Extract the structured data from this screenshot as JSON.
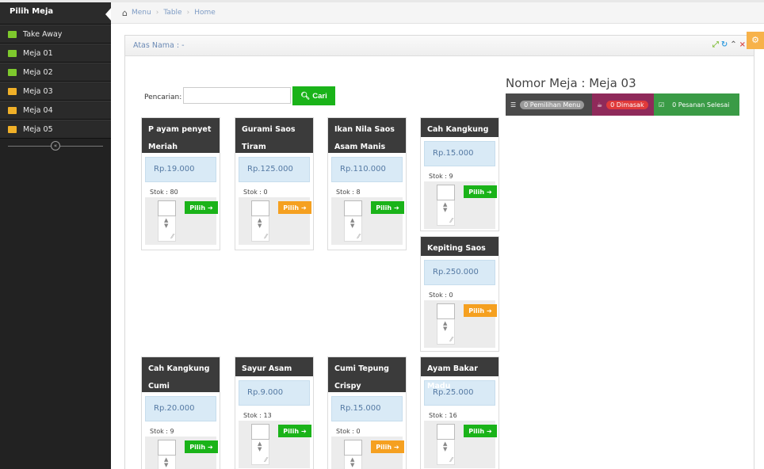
{
  "sidebar": {
    "header": "Pilih Meja",
    "items": [
      {
        "label": "Take Away",
        "icon": "takeaway-icon",
        "color": "#7ec92d"
      },
      {
        "label": "Meja 01",
        "icon": "table-icon",
        "color": "#7ec92d"
      },
      {
        "label": "Meja 02",
        "icon": "table-icon",
        "color": "#7ec92d"
      },
      {
        "label": "Meja 03",
        "icon": "table-icon",
        "color": "#f0b028"
      },
      {
        "label": "Meja 04",
        "icon": "table-icon",
        "color": "#f0b028"
      },
      {
        "label": "Meja 05",
        "icon": "table-icon",
        "color": "#f0b028"
      }
    ]
  },
  "breadcrumb": {
    "items": [
      "Menu",
      "Table",
      "Home"
    ]
  },
  "panel": {
    "title": "Atas Nama : -"
  },
  "search": {
    "label": "Pencarian:",
    "value": "",
    "button": "Cari"
  },
  "nomor_meja": "Nomor Meja : Meja 03",
  "badges": [
    {
      "label": "0 Pemilihan Menu",
      "color": "#4a4a4a"
    },
    {
      "label": "0 Dimasak",
      "color": "#8f2a5a"
    },
    {
      "label": "0 Pesanan Selesai",
      "color": "#3a9b46"
    }
  ],
  "pilih_label": "Pilih",
  "cards": [
    {
      "name": "P ayam penyet Meriah",
      "price": "Rp.19.000",
      "stok": "Stok : 80",
      "status": "green"
    },
    {
      "name": "Gurami Saos Tiram",
      "price": "Rp.125.000",
      "stok": "Stok : 0",
      "status": "orange"
    },
    {
      "name": "Ikan Nila Saos Asam Manis",
      "price": "Rp.110.000",
      "stok": "Stok : 8",
      "status": "green"
    },
    {
      "name": "Cah Kangkung",
      "price": "Rp.15.000",
      "stok": "Stok : 9",
      "status": "green"
    },
    {
      "name": "Kepiting Saos",
      "price": "Rp.250.000",
      "stok": "Stok : 0",
      "status": "orange"
    },
    {
      "name": "Cah Kangkung Cumi",
      "price": "Rp.20.000",
      "stok": "Stok : 9",
      "status": "green"
    },
    {
      "name": "Sayur Asam",
      "price": "Rp.9.000",
      "stok": "Stok : 13",
      "status": "green"
    },
    {
      "name": "Cumi Tepung Crispy",
      "price": "Rp.15.000",
      "stok": "Stok : 0",
      "status": "orange"
    },
    {
      "name": "Ayam Bakar Madu",
      "price": "Rp.25.000",
      "stok": "Stok : 16",
      "status": "green"
    }
  ]
}
